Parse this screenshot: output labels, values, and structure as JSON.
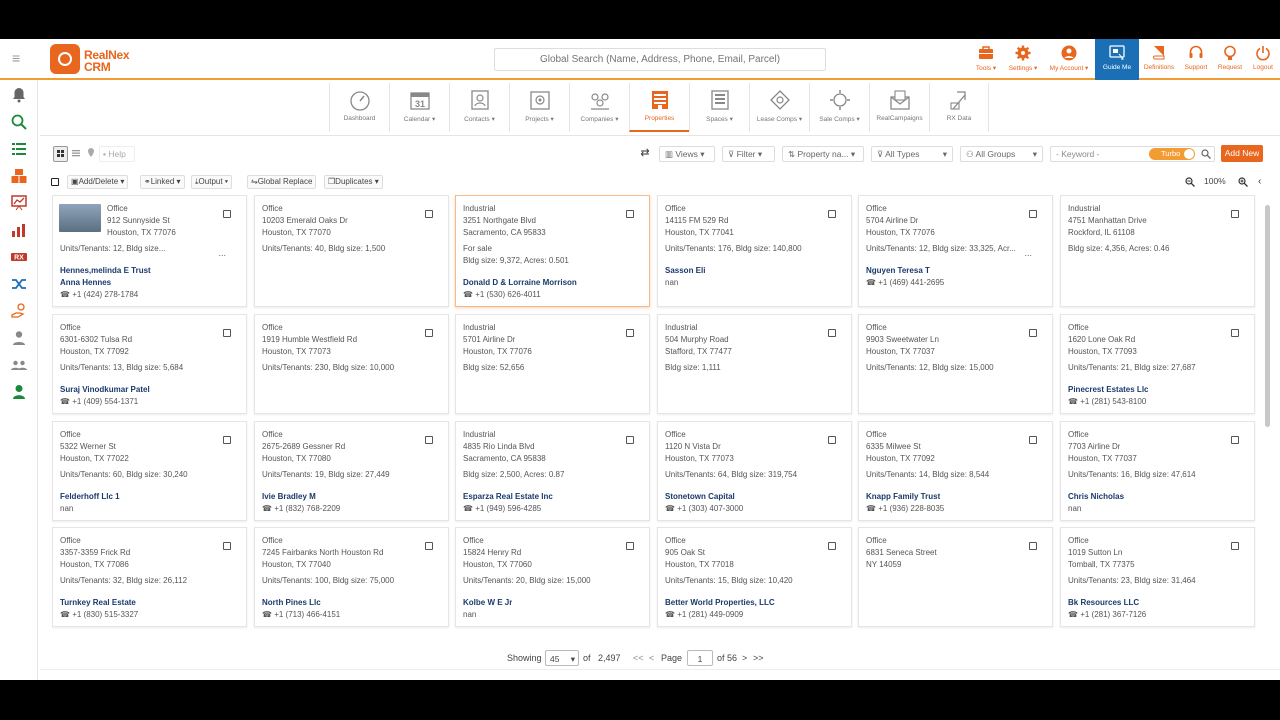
{
  "header": {
    "logo_line1": "RealNex",
    "logo_line2": "CRM",
    "search_placeholder": "Global Search (Name, Address, Phone, Email, Parcel)",
    "items": [
      {
        "label": "Tools ▾",
        "icon": "toolbox-icon"
      },
      {
        "label": "Settings ▾",
        "icon": "gear-icon"
      },
      {
        "label": "My Account ▾",
        "icon": "user-circle-icon"
      },
      {
        "label": "Guide Me",
        "icon": "guide-icon"
      },
      {
        "label": "Definitions",
        "icon": "book-icon"
      },
      {
        "label": "Support",
        "icon": "headset-icon"
      },
      {
        "label": "Request",
        "icon": "lightbulb-icon"
      },
      {
        "label": "Logout",
        "icon": "logout-icon"
      }
    ]
  },
  "modules": [
    {
      "label": "Dashboard",
      "icon": "gauge-icon"
    },
    {
      "label": "Calendar ▾",
      "icon": "calendar-icon"
    },
    {
      "label": "Contacts ▾",
      "icon": "contact-card-icon"
    },
    {
      "label": "Projects ▾",
      "icon": "project-icon"
    },
    {
      "label": "Companies ▾",
      "icon": "companies-icon"
    },
    {
      "label": "Properties",
      "icon": "building-icon"
    },
    {
      "label": "Spaces ▾",
      "icon": "spaces-icon"
    },
    {
      "label": "Lease Comps ▾",
      "icon": "lease-comps-icon"
    },
    {
      "label": "Sale Comps ▾",
      "icon": "sale-comps-icon"
    },
    {
      "label": "RealCampaigns",
      "icon": "campaign-envelope-icon"
    },
    {
      "label": "RX Data",
      "icon": "rx-data-icon"
    }
  ],
  "toolbar": {
    "help": "Help",
    "views": "Views ▾",
    "filter": "Filter ▾",
    "sort": "Property na... ▾",
    "types": "All Types",
    "groups": "All Groups",
    "keyword_placeholder": "- Keyword -",
    "turbo": "Turbo",
    "add_new": "Add New"
  },
  "toolbar2": {
    "add_delete": "Add/Delete ▾",
    "linked": "Linked ▾",
    "output": "Output ▾",
    "global_replace": "Global Replace",
    "duplicates": "Duplicates ▾",
    "zoom": "100%"
  },
  "cards": [
    {
      "type": "Office",
      "addr1": "912 Sunnyside St",
      "addr2": "Houston, TX 77076",
      "info": "Units/Tenants: 12, Bldg size...",
      "owner": "Hennes,melinda E Trust",
      "owner2": "Anna Hennes",
      "phone": "+1 (424) 278-1784",
      "thumb": true
    },
    {
      "type": "Office",
      "addr1": "10203 Emerald Oaks Dr",
      "addr2": "Houston, TX 77070",
      "info": "Units/Tenants: 40, Bldg size: 1,500"
    },
    {
      "type": "Industrial",
      "addr1": "3251 Northgate Blvd",
      "addr2": "Sacramento, CA 95833",
      "sale": "For sale",
      "info": "Bldg size: 9,372, Acres: 0.501",
      "owner": "Donald D & Lorraine Morrison",
      "phone": "+1 (530) 626-4011"
    },
    {
      "type": "Office",
      "addr1": "14115 FM 529 Rd",
      "addr2": "Houston, TX 77041",
      "info": "Units/Tenants: 176, Bldg size: 140,800",
      "owner": "Sasson Eli",
      "nan": "nan"
    },
    {
      "type": "Office",
      "addr1": "5704 Airline Dr",
      "addr2": "Houston, TX 77076",
      "info": "Units/Tenants: 12, Bldg size: 33,325, Acr...",
      "owner": "Nguyen Teresa T",
      "phone": "+1 (469) 441-2695"
    },
    {
      "type": "Industrial",
      "addr1": "4751 Manhattan Drive",
      "addr2": "Rockford, IL 61108",
      "info": "Bldg size: 4,356, Acres: 0.46"
    },
    {
      "type": "Office",
      "addr1": "6301-6302 Tulsa Rd",
      "addr2": "Houston, TX 77092",
      "info": "Units/Tenants: 13, Bldg size: 5,684",
      "owner": "Suraj Vinodkumar Patel",
      "phone": "+1 (409) 554-1371"
    },
    {
      "type": "Office",
      "addr1": "1919 Humble Westfield Rd",
      "addr2": "Houston, TX 77073",
      "info": "Units/Tenants: 230, Bldg size: 10,000"
    },
    {
      "type": "Industrial",
      "addr1": "5701 Airline Dr",
      "addr2": "Houston, TX 77076",
      "info": "Bldg size: 52,656"
    },
    {
      "type": "Industrial",
      "addr1": "504 Murphy Road",
      "addr2": "Stafford, TX 77477",
      "info": "Bldg size: 1,111"
    },
    {
      "type": "Office",
      "addr1": "9903 Sweetwater Ln",
      "addr2": "Houston, TX 77037",
      "info": "Units/Tenants: 12, Bldg size: 15,000"
    },
    {
      "type": "Office",
      "addr1": "1620 Lone Oak Rd",
      "addr2": "Houston, TX 77093",
      "info": "Units/Tenants: 21, Bldg size: 27,687",
      "owner": "Pinecrest Estates Llc",
      "phone": "+1 (281) 543-8100"
    },
    {
      "type": "Office",
      "addr1": "5322 Werner St",
      "addr2": "Houston, TX 77022",
      "info": "Units/Tenants: 60, Bldg size: 30,240",
      "owner": "Felderhoff Llc 1",
      "nan": "nan"
    },
    {
      "type": "Office",
      "addr1": "2675-2689 Gessner Rd",
      "addr2": "Houston, TX 77080",
      "info": "Units/Tenants: 19, Bldg size: 27,449",
      "owner": "Ivie Bradley M",
      "phone": "+1 (832) 768-2209"
    },
    {
      "type": "Industrial",
      "addr1": "4835 Rio Linda Blvd",
      "addr2": "Sacramento, CA 95838",
      "info": "Bldg size: 2,500, Acres: 0.87",
      "owner": "Esparza Real Estate Inc",
      "phone": "+1 (949) 596-4285"
    },
    {
      "type": "Office",
      "addr1": "1120 N Vista Dr",
      "addr2": "Houston, TX 77073",
      "info": "Units/Tenants: 64, Bldg size: 319,754",
      "owner": "Stonetown Capital",
      "phone": "+1 (303) 407-3000"
    },
    {
      "type": "Office",
      "addr1": "6335 Milwee St",
      "addr2": "Houston, TX 77092",
      "info": "Units/Tenants: 14, Bldg size: 8,544",
      "owner": "Knapp Family Trust",
      "phone": "+1 (936) 228-8035"
    },
    {
      "type": "Office",
      "addr1": "7703 Airline Dr",
      "addr2": "Houston, TX 77037",
      "info": "Units/Tenants: 16, Bldg size: 47,614",
      "owner": "Chris Nicholas",
      "nan": "nan"
    },
    {
      "type": "Office",
      "addr1": "3357-3359 Frick Rd",
      "addr2": "Houston, TX 77086",
      "info": "Units/Tenants: 32, Bldg size: 26,112",
      "owner": "Turnkey Real Estate",
      "phone": "+1 (830) 515-3327"
    },
    {
      "type": "Office",
      "addr1": "7245 Fairbanks North Houston Rd",
      "addr2": "Houston, TX 77040",
      "info": "Units/Tenants: 100, Bldg size: 75,000",
      "owner": "North Pines Llc",
      "phone": "+1 (713) 466-4151"
    },
    {
      "type": "Office",
      "addr1": "15824 Henry Rd",
      "addr2": "Houston, TX 77060",
      "info": "Units/Tenants: 20, Bldg size: 15,000",
      "owner": "Kolbe W E Jr",
      "nan": "nan"
    },
    {
      "type": "Office",
      "addr1": "905 Oak St",
      "addr2": "Houston, TX 77018",
      "info": "Units/Tenants: 15, Bldg size: 10,420",
      "owner": "Better World Properties, LLC",
      "phone": "+1 (281) 449-0909"
    },
    {
      "type": "Office",
      "addr1": "6831 Seneca Street",
      "addr2": "NY 14059"
    },
    {
      "type": "Office",
      "addr1": "1019 Sutton Ln",
      "addr2": "Tomball, TX 77375",
      "info": "Units/Tenants: 23, Bldg size: 31,464",
      "owner": "Bk Resources LLC",
      "phone": "+1 (281) 367-7126"
    }
  ],
  "pager": {
    "showing": "Showing",
    "page_size": "45",
    "of": "of",
    "total": "2,497",
    "first": "<<",
    "prev": "<",
    "page_label": "Page",
    "page": "1",
    "of_pages": "of 56",
    "next": ">",
    "last": ">>"
  },
  "colors": {
    "accent": "#e8661d",
    "guide_bg": "#1a6fb5",
    "owner_text": "#1a3a6b"
  }
}
